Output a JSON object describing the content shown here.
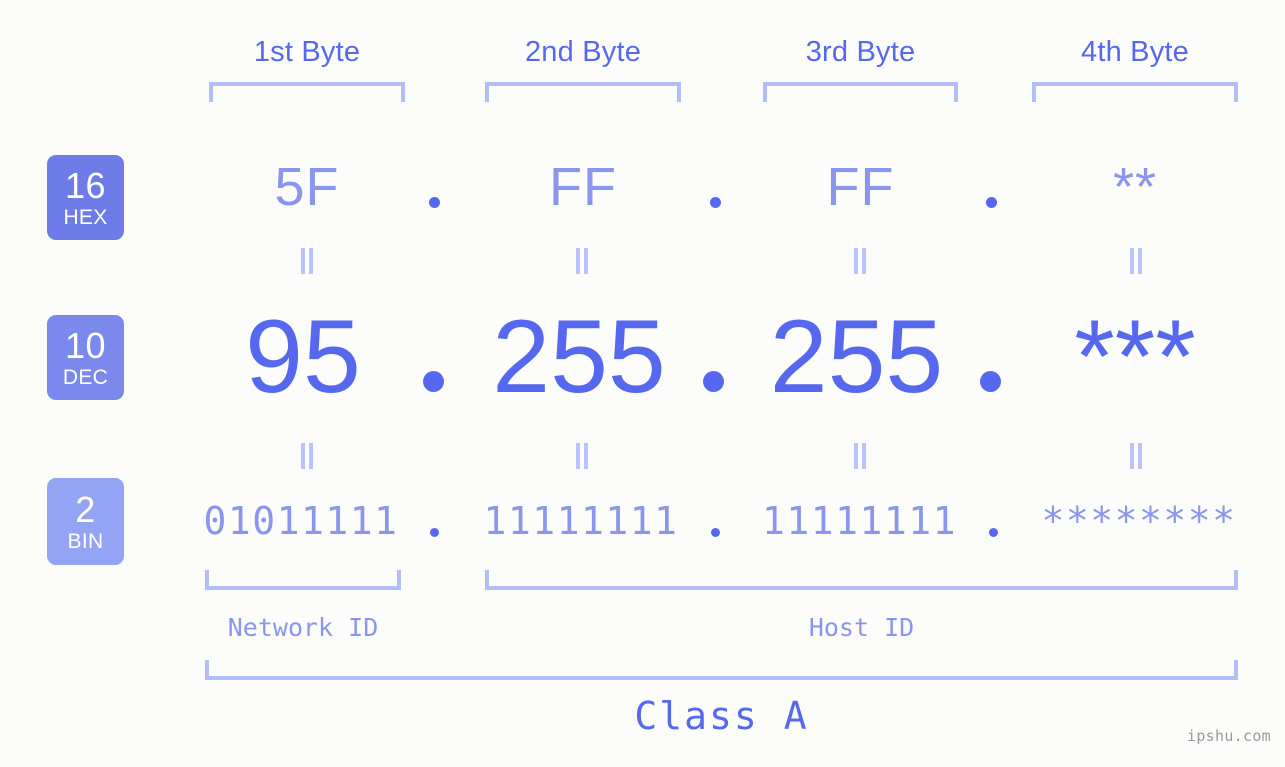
{
  "background_color": "#fcfdfa",
  "accent_color": "#5669ee",
  "muted_accent_color": "#8a95ee",
  "bracket_color": "#b3bdfa",
  "byte_headers": [
    {
      "label": "1st Byte"
    },
    {
      "label": "2nd Byte"
    },
    {
      "label": "3rd Byte"
    },
    {
      "label": "4th Byte"
    }
  ],
  "rows": {
    "hex": {
      "badge_number": "16",
      "badge_abbr": "HEX",
      "badge_color": "#6e7ce8",
      "values": [
        "5F",
        "FF",
        "FF",
        "**"
      ]
    },
    "dec": {
      "badge_number": "10",
      "badge_abbr": "DEC",
      "badge_color": "#7b88ec",
      "values": [
        "95",
        "255",
        "255",
        "***"
      ]
    },
    "bin": {
      "badge_number": "2",
      "badge_abbr": "BIN",
      "badge_color": "#94a4f4",
      "values": [
        "01011111",
        "11111111",
        "11111111",
        "********"
      ]
    }
  },
  "separator": ".",
  "equals_marks": "||",
  "footer": {
    "network_id_label": "Network ID",
    "host_id_label": "Host ID",
    "class_label": "Class A"
  },
  "watermark": "ipshu.com"
}
